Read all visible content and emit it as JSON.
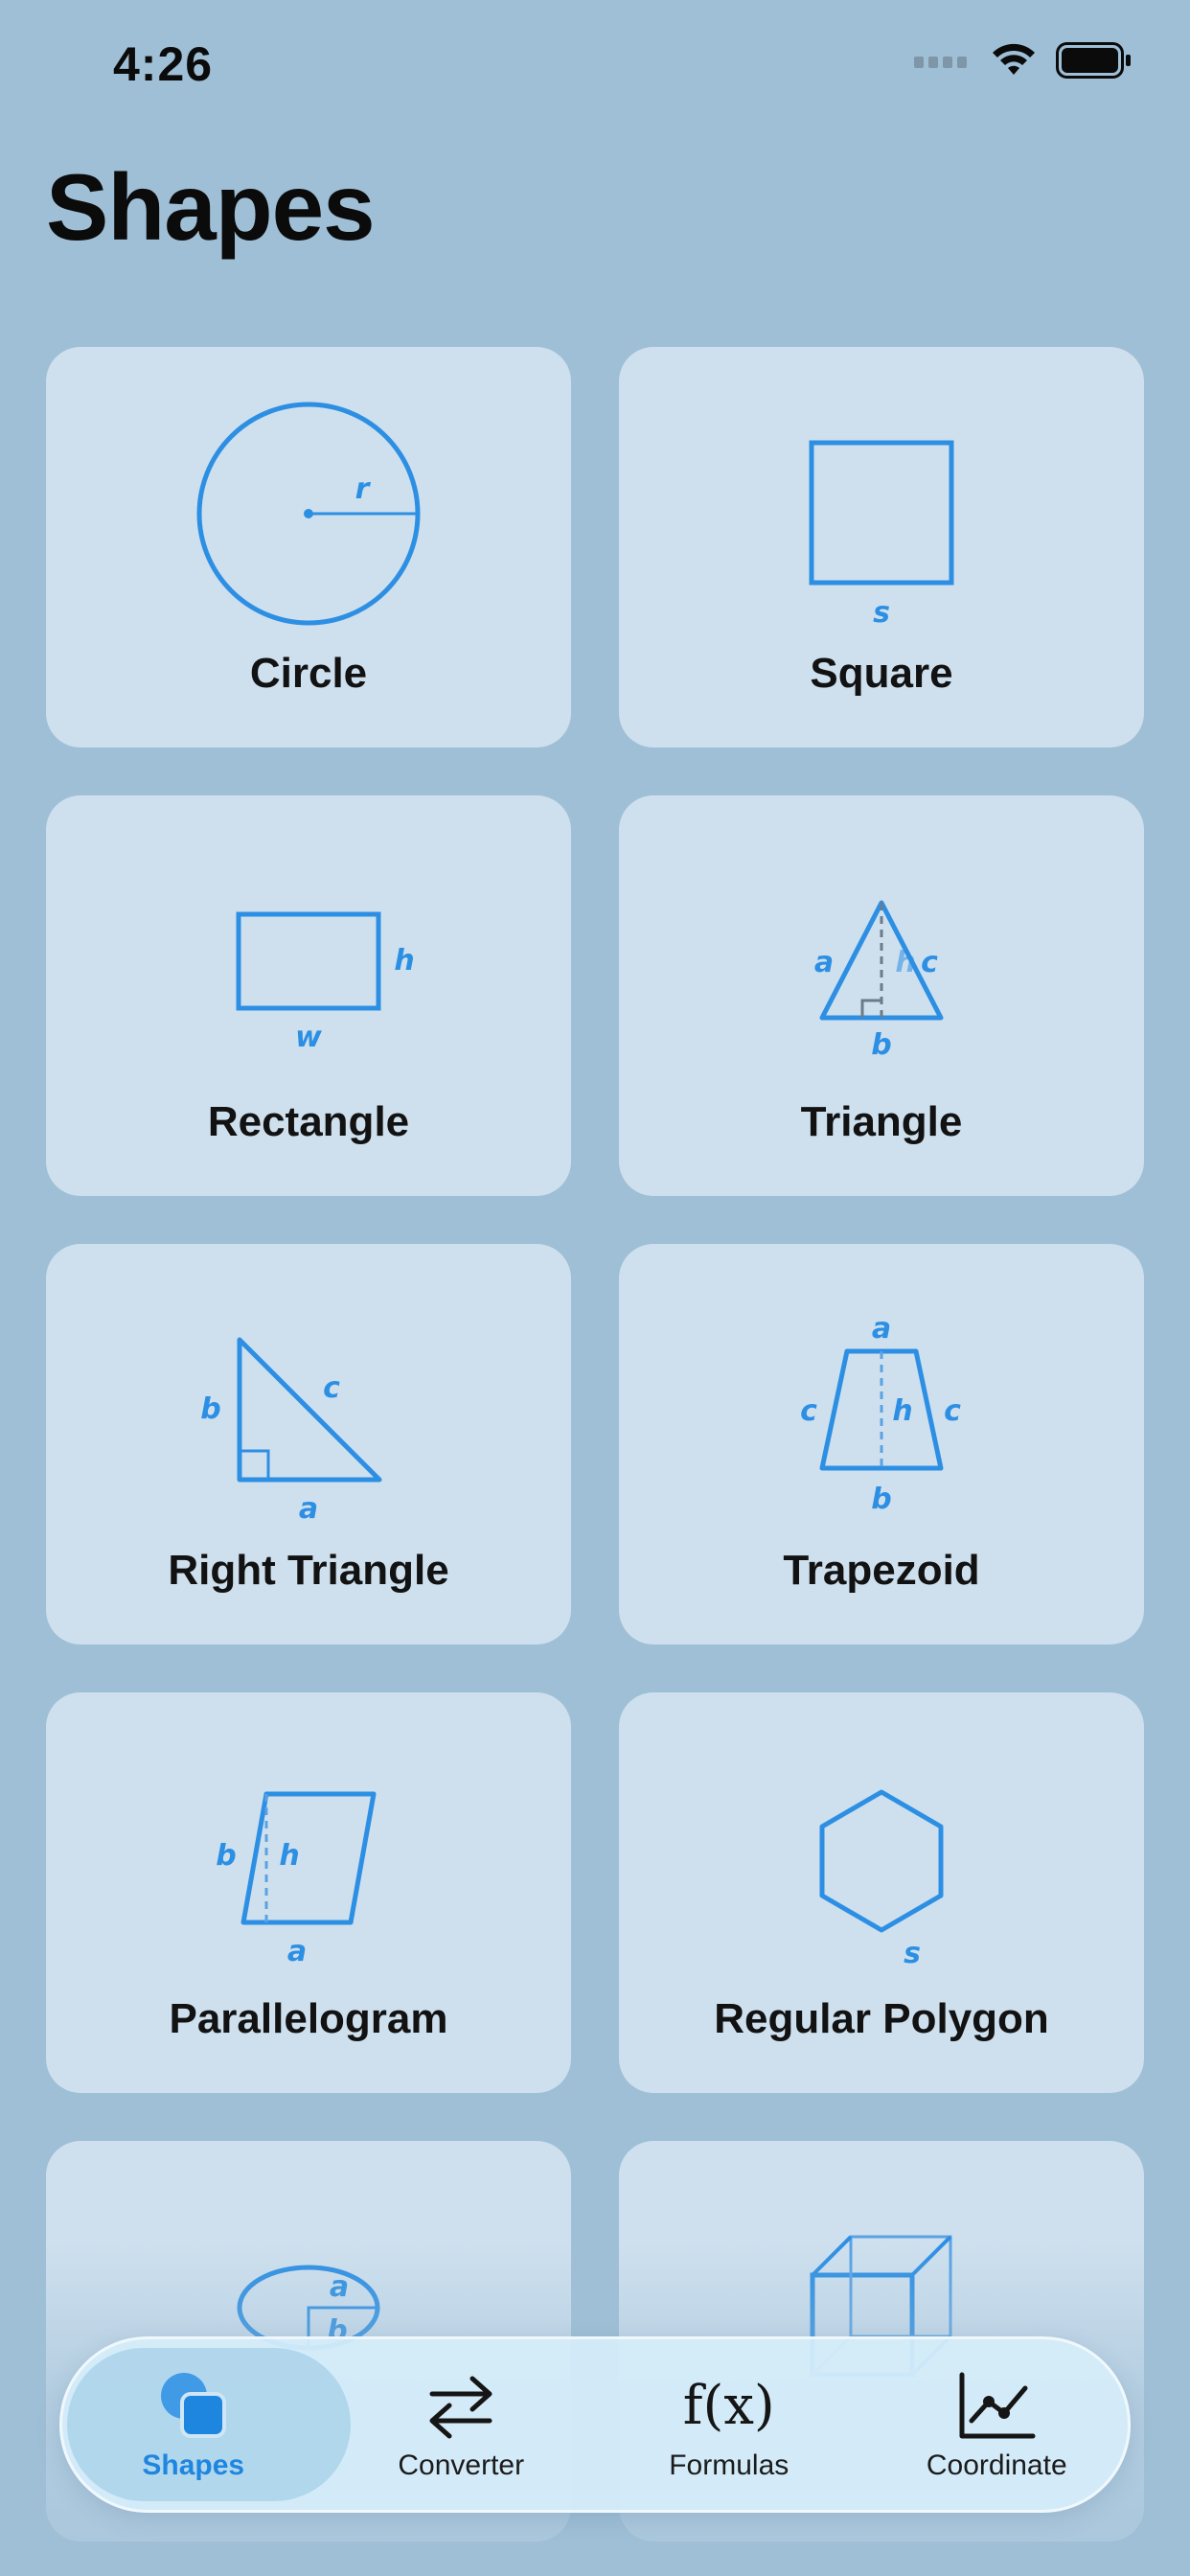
{
  "status_bar": {
    "time": "4:26"
  },
  "page": {
    "title": "Shapes"
  },
  "shapes": [
    {
      "name": "Circle",
      "labels": [
        "r"
      ]
    },
    {
      "name": "Square",
      "labels": [
        "s"
      ]
    },
    {
      "name": "Rectangle",
      "labels": [
        "h",
        "w"
      ]
    },
    {
      "name": "Triangle",
      "labels": [
        "a",
        "h",
        "c",
        "b"
      ]
    },
    {
      "name": "Right Triangle",
      "labels": [
        "b",
        "c",
        "a"
      ]
    },
    {
      "name": "Trapezoid",
      "labels": [
        "a",
        "c",
        "h",
        "c",
        "b"
      ]
    },
    {
      "name": "Parallelogram",
      "labels": [
        "b",
        "h",
        "a"
      ]
    },
    {
      "name": "Regular Polygon",
      "labels": [
        "s"
      ]
    },
    {
      "name": "",
      "labels": [
        "a",
        "b"
      ]
    },
    {
      "name": "",
      "labels": []
    }
  ],
  "tab_bar": {
    "tabs": [
      {
        "label": "Shapes",
        "icon": "shapes-icon",
        "active": true
      },
      {
        "label": "Converter",
        "icon": "arrows-left-right-icon",
        "active": false
      },
      {
        "label": "Formulas",
        "icon": "function-icon",
        "active": false
      },
      {
        "label": "Coordinate",
        "icon": "line-chart-icon",
        "active": false
      }
    ],
    "formulas_glyph": "f(x)"
  },
  "colors": {
    "accent": "#2d8fe3",
    "background": "#9fbfd6",
    "card": "#cee0ee"
  }
}
